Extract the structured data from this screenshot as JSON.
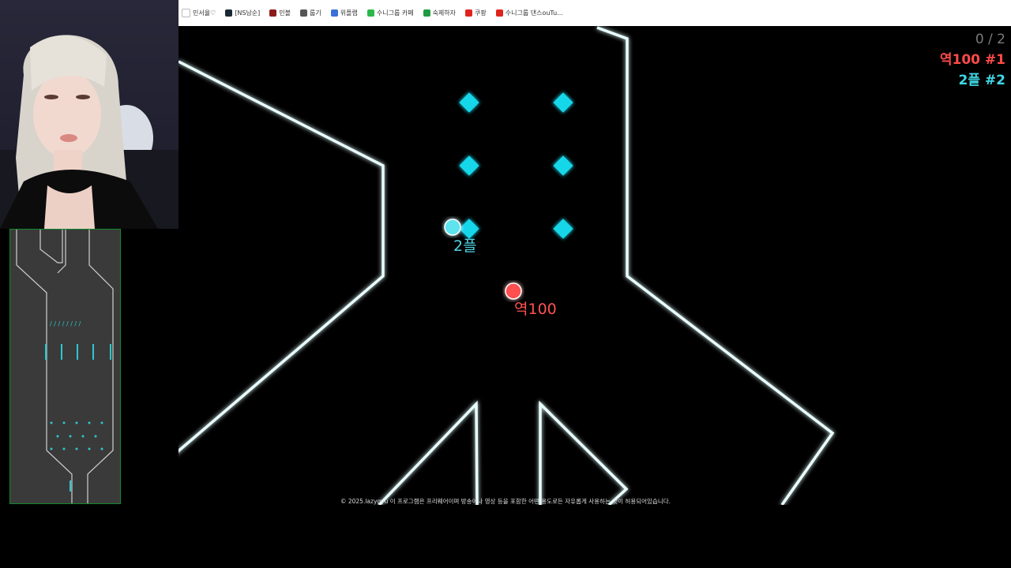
{
  "bookmarks": [
    {
      "label": "민서율♡",
      "icon": "heart-icon",
      "color": "#ffffff"
    },
    {
      "label": "[NS남순]",
      "icon": "tv-icon",
      "color": "#1b2735"
    },
    {
      "label": "민볼",
      "icon": "app-icon",
      "color": "#8b1a1a"
    },
    {
      "label": "룹기",
      "icon": "globe-icon",
      "color": "#555555"
    },
    {
      "label": "위플랩",
      "icon": "gm-icon",
      "color": "#3b6fd8"
    },
    {
      "label": "수니그룹 카페",
      "icon": "leaf-icon",
      "color": "#2bb84a"
    },
    {
      "label": "숙제하자",
      "icon": "plus-icon",
      "color": "#1e9b41"
    },
    {
      "label": "쿠팡",
      "icon": "circle-icon",
      "color": "#e0241b"
    },
    {
      "label": "수니그룹 댄스ouTu...",
      "icon": "youtube-icon",
      "color": "#e0241b"
    }
  ],
  "scoreboard": {
    "count": "0 / 2",
    "player1": "역100 #1",
    "player2": "2플 #2"
  },
  "players": {
    "p2_label": "2플",
    "p1_label": "역100",
    "p2_color": "#5fe3ee",
    "p1_color": "#ff4f4f"
  },
  "colors": {
    "wall": "#e8ffff",
    "wall_glow": "#00e5ff",
    "diamond": "#19d6ea",
    "minimap_bg": "#3a3a3a"
  },
  "copyright": "© 2025.lazygyu 이 프로그램은 프리웨어이며 방송이나 영상 등을 포함한 어떤 용도로든 자유롭게 사용하는 것이 허용되어있습니다."
}
